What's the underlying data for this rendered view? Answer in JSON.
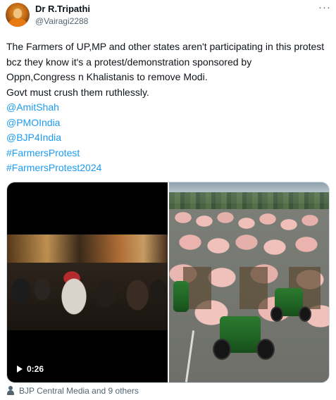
{
  "author": {
    "name": "Dr R.Tripathi",
    "handle": "@Vairagi2288",
    "avatar_icon": "saffron-robed-avatar"
  },
  "more_icon": "···",
  "tweet": {
    "lines": [
      "The Farmers of UP,MP and other states aren't participating in this protest",
      "bcz they know it's a protest/demonstration sponsored by",
      "Oppn,Congress n Khalistanis to remove Modi.",
      "Govt must crush them ruthlessly."
    ],
    "links": [
      "@AmitShah",
      "@PMOIndia",
      "@BJP4India",
      "#FarmersProtest",
      "#FarmersProtest2024"
    ]
  },
  "media": {
    "video": {
      "duration": "0:26",
      "icon": "play-icon"
    },
    "photo": {
      "icon": "image-thumbnail"
    }
  },
  "footer": {
    "tagged": "BJP Central Media and 9 others",
    "icon": "person-icon"
  },
  "colors": {
    "link": "#1d9bf0",
    "secondary_text": "#536471",
    "primary_text": "#0f1419"
  }
}
